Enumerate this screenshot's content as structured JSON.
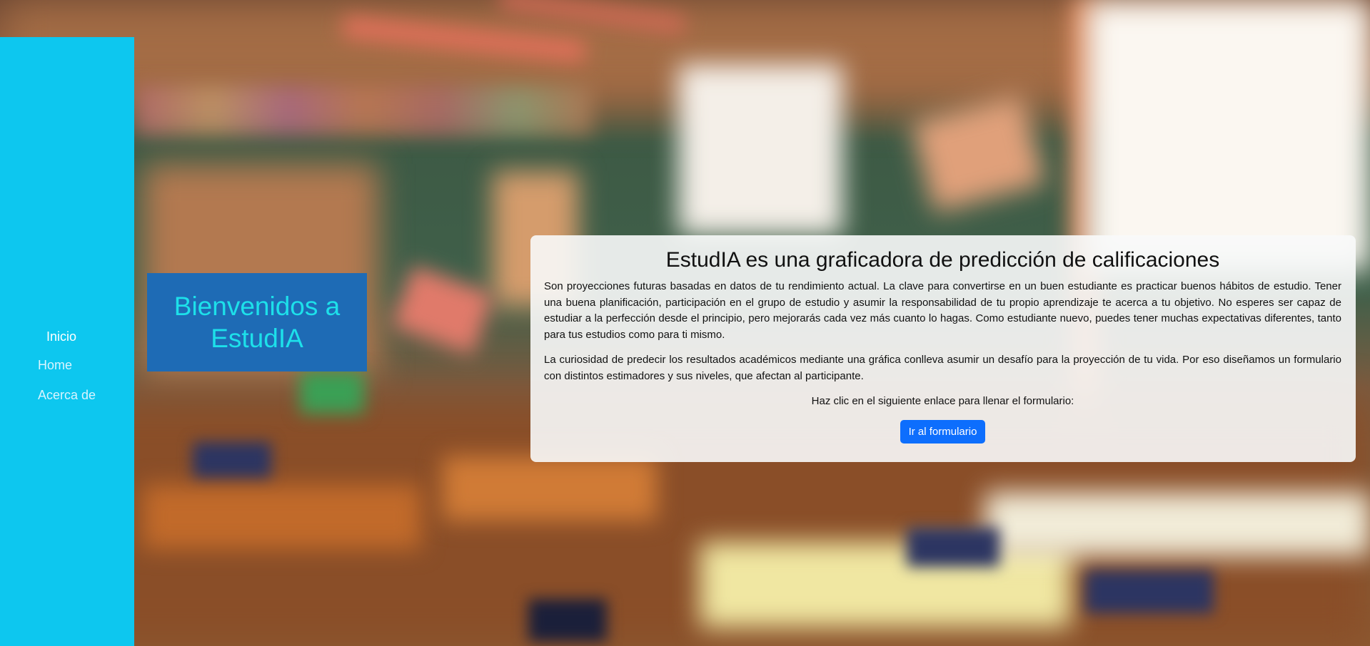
{
  "sidebar": {
    "title": "Inicio",
    "items": [
      {
        "label": "Home"
      },
      {
        "label": "Acerca de"
      }
    ]
  },
  "welcome": {
    "heading": "Bienvenidos a EstudIA"
  },
  "card": {
    "title": "EstudIA es una graficadora de predicción de calificaciones",
    "paragraph1": "Son proyecciones futuras basadas en datos de tu rendimiento actual. La clave para convertirse en un buen estudiante es practicar buenos hábitos de estudio. Tener una buena planificación, participación en el grupo de estudio y asumir la responsabilidad de tu propio aprendizaje te acerca a tu objetivo. No esperes ser capaz de estudiar a la perfección desde el principio, pero mejorarás cada vez más cuanto lo hagas. Como estudiante nuevo, puedes tener muchas expectativas diferentes, tanto para tus estudios como para ti mismo.",
    "paragraph2": "La curiosidad de predecir los resultados académicos mediante una gráfica conlleva asumir un desafío para la proyección de tu vida. Por eso diseñamos un formulario con distintos estimadores y sus niveles, que afectan al participante.",
    "instruction": "Haz clic en el siguiente enlace para llenar el formulario:",
    "button_label": "Ir al formulario"
  },
  "colors": {
    "sidebar": "#0dc7ef",
    "welcome_bg": "#1e6bb5",
    "welcome_text": "#1de0ea",
    "button": "#0d6efd"
  }
}
